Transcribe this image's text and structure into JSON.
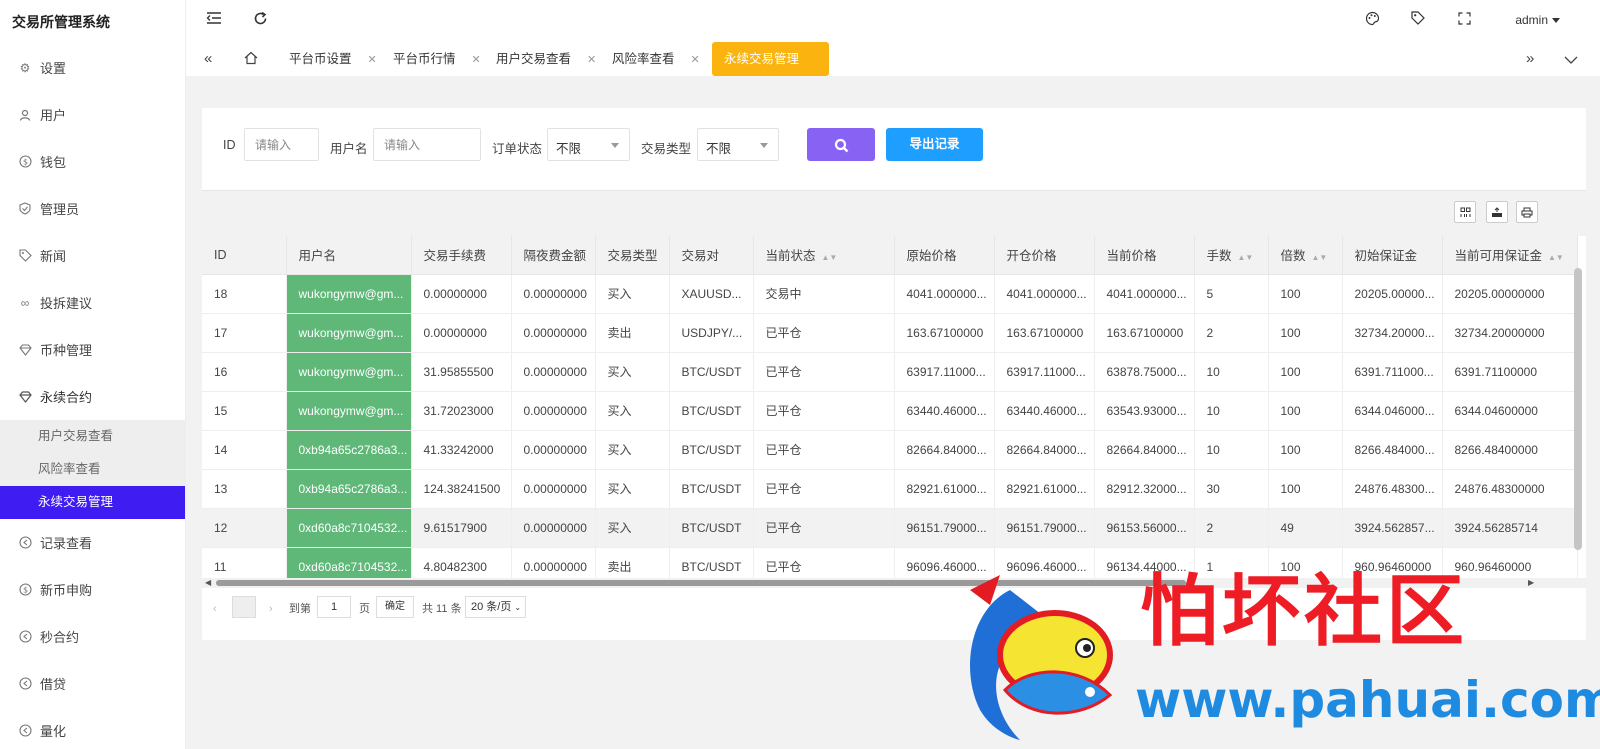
{
  "app": {
    "title": "交易所管理系统"
  },
  "sidebar": {
    "items": [
      {
        "label": "设置",
        "icon": "gear-icon"
      },
      {
        "label": "用户",
        "icon": "user-icon"
      },
      {
        "label": "钱包",
        "icon": "wallet-icon"
      },
      {
        "label": "管理员",
        "icon": "shield-icon"
      },
      {
        "label": "新闻",
        "icon": "tag-icon"
      },
      {
        "label": "投拆建议",
        "icon": "link-icon"
      },
      {
        "label": "币种管理",
        "icon": "diamond-icon"
      },
      {
        "label": "永续合约",
        "icon": "diamond-icon"
      },
      {
        "label": "记录查看",
        "icon": "circle-arrow-icon"
      },
      {
        "label": "新币申购",
        "icon": "dollar-icon"
      },
      {
        "label": "秒合约",
        "icon": "circle-arrow-icon"
      },
      {
        "label": "借贷",
        "icon": "circle-arrow-icon"
      },
      {
        "label": "量化",
        "icon": "circle-arrow-icon"
      }
    ],
    "submenu": [
      {
        "label": "用户交易查看"
      },
      {
        "label": "风险率查看"
      },
      {
        "label": "永续交易管理"
      }
    ]
  },
  "topbar": {
    "user": "admin"
  },
  "tabs": [
    {
      "label": "平台币设置"
    },
    {
      "label": "平台币行情"
    },
    {
      "label": "用户交易查看"
    },
    {
      "label": "风险率查看"
    },
    {
      "label": "永续交易管理"
    }
  ],
  "filter": {
    "id_label": "ID",
    "id_placeholder": "请输入",
    "username_label": "用户名",
    "username_placeholder": "请输入",
    "order_status_label": "订单状态",
    "order_status_value": "不限",
    "trade_type_label": "交易类型",
    "trade_type_value": "不限",
    "export_label": "导出记录"
  },
  "table": {
    "headers": [
      "ID",
      "用户名",
      "交易手续费",
      "隔夜费金额",
      "交易类型",
      "交易对",
      "当前状态",
      "原始价格",
      "开仓价格",
      "当前价格",
      "手数",
      "倍数",
      "初始保证金",
      "当前可用保证金"
    ],
    "rows": [
      [
        "18",
        "wukongymw@gm...",
        "0.00000000",
        "0.00000000",
        "买入",
        "XAUUSD...",
        "交易中",
        "4041.000000...",
        "4041.000000...",
        "4041.000000...",
        "5",
        "100",
        "20205.00000...",
        "20205.00000000"
      ],
      [
        "17",
        "wukongymw@gm...",
        "0.00000000",
        "0.00000000",
        "卖出",
        "USDJPY/...",
        "已平仓",
        "163.67100000",
        "163.67100000",
        "163.67100000",
        "2",
        "100",
        "32734.20000...",
        "32734.20000000"
      ],
      [
        "16",
        "wukongymw@gm...",
        "31.95855500",
        "0.00000000",
        "买入",
        "BTC/USDT",
        "已平仓",
        "63917.11000...",
        "63917.11000...",
        "63878.75000...",
        "10",
        "100",
        "6391.711000...",
        "6391.71100000"
      ],
      [
        "15",
        "wukongymw@gm...",
        "31.72023000",
        "0.00000000",
        "买入",
        "BTC/USDT",
        "已平仓",
        "63440.46000...",
        "63440.46000...",
        "63543.93000...",
        "10",
        "100",
        "6344.046000...",
        "6344.04600000"
      ],
      [
        "14",
        "0xb94a65c2786a3...",
        "41.33242000",
        "0.00000000",
        "买入",
        "BTC/USDT",
        "已平仓",
        "82664.84000...",
        "82664.84000...",
        "82664.84000...",
        "10",
        "100",
        "8266.484000...",
        "8266.48400000"
      ],
      [
        "13",
        "0xb94a65c2786a3...",
        "124.38241500",
        "0.00000000",
        "买入",
        "BTC/USDT",
        "已平仓",
        "82921.61000...",
        "82921.61000...",
        "82912.32000...",
        "30",
        "100",
        "24876.48300...",
        "24876.48300000"
      ],
      [
        "12",
        "0xd60a8c7104532...",
        "9.61517900",
        "0.00000000",
        "买入",
        "BTC/USDT",
        "已平仓",
        "96151.79000...",
        "96151.79000...",
        "96153.56000...",
        "2",
        "49",
        "3924.562857...",
        "3924.56285714"
      ],
      [
        "11",
        "0xd60a8c7104532...",
        "4.80482300",
        "0.00000000",
        "卖出",
        "BTC/USDT",
        "已平仓",
        "96096.46000...",
        "96096.46000...",
        "96134.44000...",
        "1",
        "100",
        "960.96460000",
        "960.96460000"
      ]
    ]
  },
  "pager": {
    "goto_label": "到第",
    "page_value": "1",
    "page_unit": "页",
    "confirm_label": "确定",
    "total_label": "共 11 条",
    "page_size_label": "20 条/页"
  },
  "watermark": {
    "text": "怕坏社区",
    "url": "www.pahuai.com"
  },
  "colors": {
    "active_menu": "#3f1cf2",
    "active_tab": "#fbb30f",
    "search_button": "#8862f2",
    "export_button": "#1e9fff",
    "username_cell": "#5fb878"
  }
}
